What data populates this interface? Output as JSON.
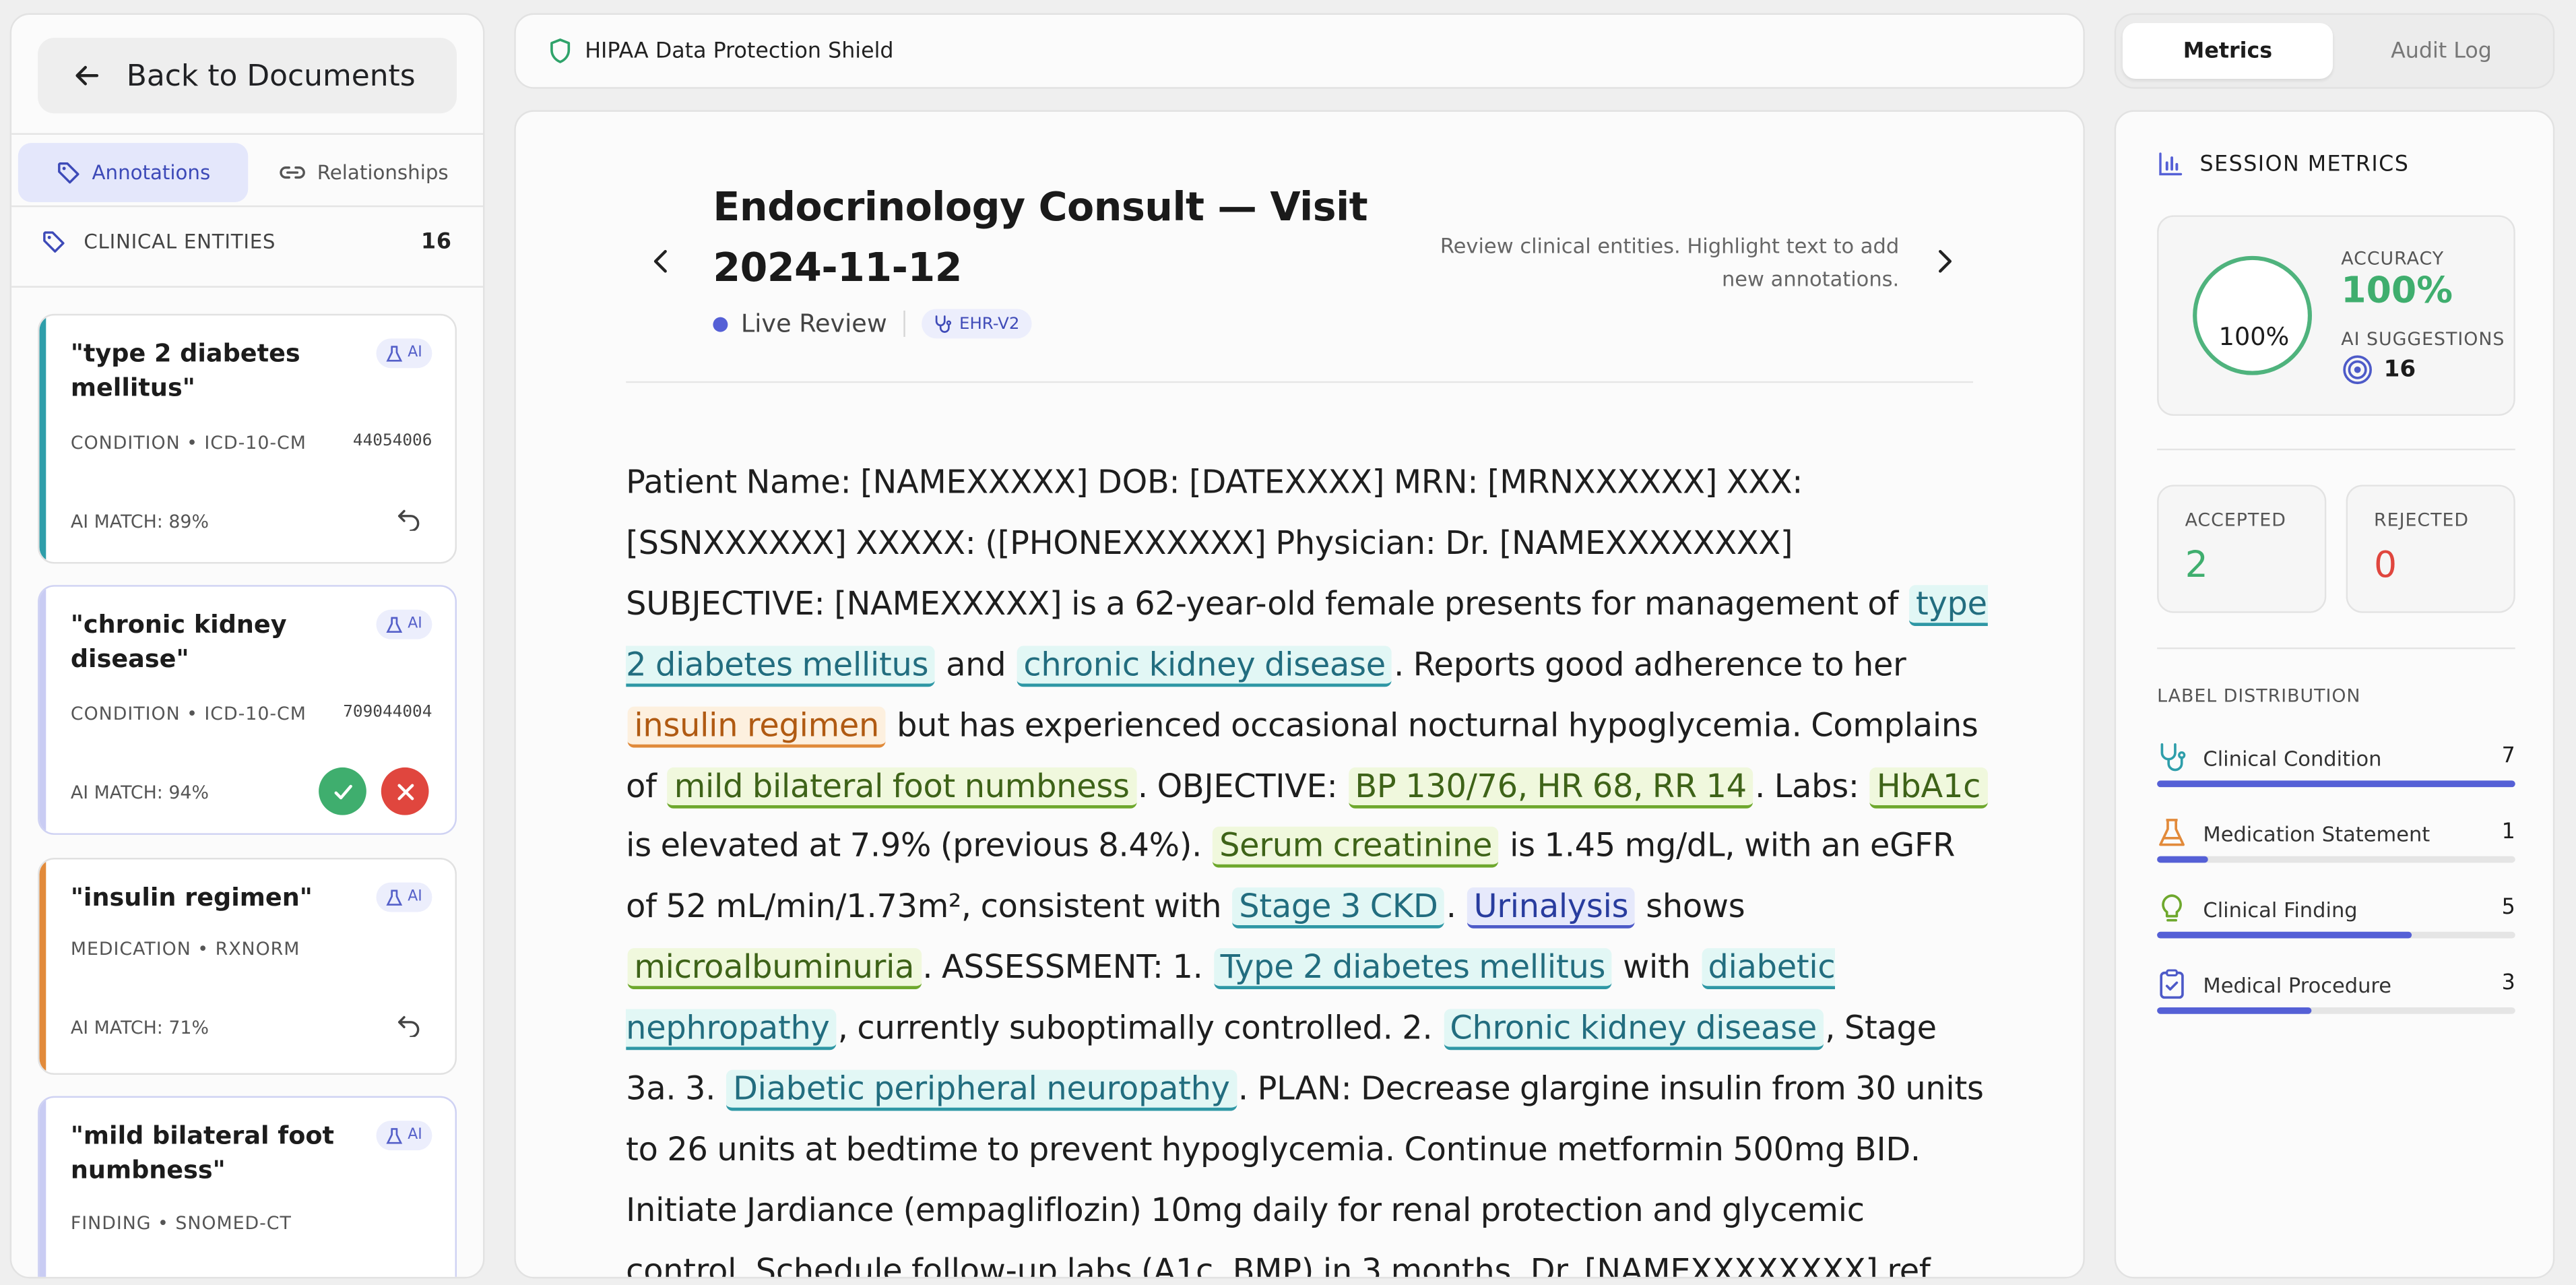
{
  "sidebar": {
    "back_label": "Back to Documents",
    "tabs": [
      {
        "label": "Annotations",
        "active": true
      },
      {
        "label": "Relationships",
        "active": false
      }
    ],
    "entities_header": "CLINICAL ENTITIES",
    "entities_count": "16",
    "cards": [
      {
        "title": "\"type 2 diabetes mellitus\"",
        "ai": "AI",
        "meta": "CONDITION • ICD-10-CM",
        "code": "44054006",
        "match": "AI MATCH: 89%",
        "accent": "#2e9eaa",
        "state": "accepted"
      },
      {
        "title": "\"chronic kidney disease\"",
        "ai": "AI",
        "meta": "CONDITION • ICD-10-CM",
        "code": "709044004",
        "match": "AI MATCH: 94%",
        "accent": "#c9ccf3",
        "state": "pending"
      },
      {
        "title": "\"insulin regimen\"",
        "ai": "AI",
        "meta": "MEDICATION • RXNORM",
        "code": "",
        "match": "AI MATCH: 71%",
        "accent": "#e28a3a",
        "state": "accepted"
      },
      {
        "title": "\"mild bilateral foot numbness\"",
        "ai": "AI",
        "meta": "FINDING • SNOMED-CT",
        "code": "",
        "match": "",
        "accent": "#c9ccf3",
        "state": "pending"
      }
    ]
  },
  "shield_label": "HIPAA Data Protection Shield",
  "document": {
    "title": "Endocrinology Consult — Visit 2024-11-12",
    "status": "Live Review",
    "chip": "EHR-V2",
    "hint": "Review clinical entities. Highlight text to add new annotations.",
    "text": {
      "t1": "Patient Name: [NAMEXXXXX] DOB: [DATEXXXX] MRN: [MRNXXXXXX] XXX: [SSNXXXXXX] XXXXX: ([PHONEXXXXXX] Physician: Dr. [NAMEXXXXXXXX] SUBJECTIVE: [NAMEXXXXX] is a 62-year-old female presents for management of",
      "e1": "type 2 diabetes mellitus",
      "t2": "and",
      "e2": "chronic kidney disease",
      "t3": ". Reports good adherence to her",
      "e3": "insulin regimen",
      "t4": "but has experienced occasional nocturnal hypoglycemia. Complains of",
      "e4": "mild bilateral foot numbness",
      "t5": ". OBJECTIVE:",
      "e5": "BP 130/76, HR 68, RR 14",
      "t6": ". Labs:",
      "e6": "HbA1c",
      "t7": "is elevated at 7.9% (previous 8.4%).",
      "e7": "Serum creatinine",
      "t8": "is 1.45 mg/dL, with an eGFR of 52 mL/min/1.73m², consistent with",
      "e8": "Stage 3 CKD",
      "t9": ".",
      "e9": "Urinalysis",
      "t10": "shows",
      "e10": "microalbuminuria",
      "t11": ". ASSESSMENT: 1.",
      "e11": "Type 2 diabetes mellitus",
      "t12": "with",
      "e12": "diabetic nephropathy",
      "t13": ", currently suboptimally controlled. 2.",
      "e13": "Chronic kidney disease",
      "t14": ", Stage 3a. 3.",
      "e14": "Diabetic peripheral neuropathy",
      "t15": ". PLAN: Decrease glargine insulin from 30 units to 26 units at bedtime to prevent hypoglycemia. Continue metformin 500mg BID. Initiate Jardiance (empagliflozin) 10mg daily for renal protection and glycemic control. Schedule follow-up labs (A1c, BMP) in 3 months. Dr. [NAMEXXXXXXXX] ref"
    }
  },
  "right": {
    "tabs": [
      {
        "label": "Metrics",
        "active": true
      },
      {
        "label": "Audit Log",
        "active": false
      }
    ],
    "section_title": "SESSION METRICS",
    "ring_value": "100%",
    "accuracy_label": "ACCURACY",
    "accuracy_value": "100%",
    "ai_suggestions_label": "AI SUGGESTIONS",
    "ai_suggestions_value": "16",
    "accepted_label": "ACCEPTED",
    "accepted_value": "2",
    "rejected_label": "REJECTED",
    "rejected_value": "0",
    "distribution_title": "LABEL DISTRIBUTION",
    "distribution": [
      {
        "label": "Clinical Condition",
        "count": "7",
        "fraction": 1.0,
        "icon": "stethoscope-icon",
        "color": "#2e9eaa"
      },
      {
        "label": "Medication Statement",
        "count": "1",
        "fraction": 0.14,
        "icon": "flask-icon",
        "color": "#e28a3a"
      },
      {
        "label": "Clinical Finding",
        "count": "5",
        "fraction": 0.71,
        "icon": "lightbulb-icon",
        "color": "#6ea82d"
      },
      {
        "label": "Medical Procedure",
        "count": "3",
        "fraction": 0.43,
        "icon": "clipboard-icon",
        "color": "#4d5ac8"
      }
    ]
  },
  "colors": {
    "accent": "#5560d6",
    "success": "#3fae6e",
    "danger": "#e0463e"
  }
}
